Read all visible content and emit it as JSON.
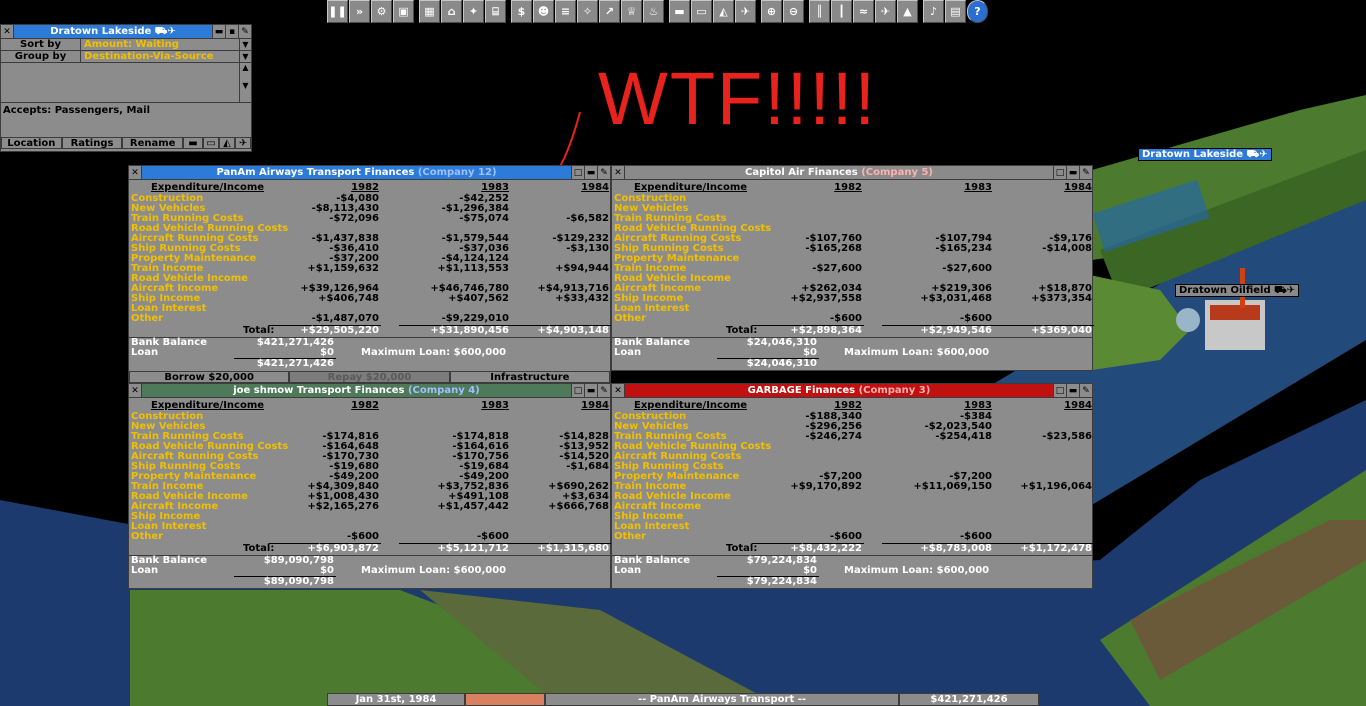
{
  "annotation": {
    "text": "WTF!!!!!",
    "color": "#e8221c"
  },
  "toolbar": {
    "icons": [
      "pause-icon",
      "fast-forward-icon",
      "settings-icon",
      "save-icon",
      "minimap-icon",
      "town-directory-icon",
      "subsidies-icon",
      "station-list-icon",
      "finances-icon",
      "company-general-icon",
      "story-book-icon",
      "goal-list-icon",
      "graphs-icon",
      "league-icon",
      "industry-icon",
      "train-list-icon",
      "road-vehicle-list-icon",
      "ship-list-icon",
      "aircraft-list-icon",
      "zoom-in-icon",
      "zoom-out-icon",
      "build-rail-icon",
      "build-road-icon",
      "build-water-icon",
      "build-air-icon",
      "landscaping-icon",
      "music-icon",
      "messages-icon",
      "help-icon"
    ]
  },
  "station_window": {
    "title": "Dratown Lakeside",
    "sort_label": "Sort by",
    "sort_value": "Amount: Waiting",
    "group_label": "Group by",
    "group_value": "Destination-Via-Source",
    "accepts": "Accepts: Passengers, Mail",
    "buttons": {
      "location": "Location",
      "ratings": "Ratings",
      "rename": "Rename"
    }
  },
  "signs": {
    "station": "Dratown Lakeside",
    "oilfield": "Dratown Oilfield"
  },
  "years": [
    "1982",
    "1983",
    "1984"
  ],
  "row_labels": [
    "Construction",
    "New Vehicles",
    "Train Running Costs",
    "Road Vehicle Running Costs",
    "Aircraft Running Costs",
    "Ship Running Costs",
    "Property Maintenance",
    "Train Income",
    "Road Vehicle Income",
    "Aircraft Income",
    "Ship Income",
    "Loan Interest",
    "Other"
  ],
  "labels": {
    "exp_income": "Expenditure/Income",
    "total": "Total:",
    "bank_balance": "Bank Balance",
    "loan": "Loan",
    "max_loan": "Maximum Loan:"
  },
  "finances": [
    {
      "company": "PanAm Airways Transport Finances",
      "company_no": "(Company 12)",
      "title_color": "#2d7bd8",
      "cells": [
        [
          "-$4,080",
          "-$42,252",
          ""
        ],
        [
          "-$8,113,430",
          "-$1,296,384",
          ""
        ],
        [
          "-$72,096",
          "-$75,074",
          "-$6,582"
        ],
        [
          "",
          "",
          ""
        ],
        [
          "-$1,437,838",
          "-$1,579,544",
          "-$129,232"
        ],
        [
          "-$36,410",
          "-$37,036",
          "-$3,130"
        ],
        [
          "-$37,200",
          "-$4,124,124",
          ""
        ],
        [
          "+$1,159,632",
          "+$1,113,553",
          "+$94,944"
        ],
        [
          "",
          "",
          ""
        ],
        [
          "+$39,126,964",
          "+$46,746,780",
          "+$4,913,716"
        ],
        [
          "+$406,748",
          "+$407,562",
          "+$33,432"
        ],
        [
          "",
          "",
          ""
        ],
        [
          "-$1,487,070",
          "-$9,229,010",
          ""
        ]
      ],
      "totals": [
        "+$29,505,220",
        "+$31,890,456",
        "+$4,903,148"
      ],
      "bank_balance": "$421,271,426",
      "loan": "$0",
      "max_loan": "$600,000",
      "net": "$421,271,426",
      "buttons": {
        "borrow": "Borrow $20,000",
        "repay": "Repay $20,000",
        "infrastructure": "Infrastructure"
      }
    },
    {
      "company": "Capitol Air Finances",
      "company_no": "(Company 5)",
      "title_color": "#8a8a8a",
      "cells": [
        [
          "",
          "",
          ""
        ],
        [
          "",
          "",
          ""
        ],
        [
          "",
          "",
          ""
        ],
        [
          "",
          "",
          ""
        ],
        [
          "-$107,760",
          "-$107,794",
          "-$9,176"
        ],
        [
          "-$165,268",
          "-$165,234",
          "-$14,008"
        ],
        [
          "",
          "",
          ""
        ],
        [
          "-$27,600",
          "-$27,600",
          ""
        ],
        [
          "",
          "",
          ""
        ],
        [
          "+$262,034",
          "+$219,306",
          "+$18,870"
        ],
        [
          "+$2,937,558",
          "+$3,031,468",
          "+$373,354"
        ],
        [
          "",
          "",
          ""
        ],
        [
          "",
          "",
          ""
        ],
        [
          "-$600",
          "-$600",
          ""
        ]
      ],
      "totals": [
        "+$2,898,364",
        "+$2,949,546",
        "+$369,040"
      ],
      "bank_balance": "$24,046,310",
      "loan": "$0",
      "max_loan": "$600,000",
      "net": "$24,046,310"
    },
    {
      "company": "joe shmow Transport Finances",
      "company_no": "(Company 4)",
      "title_color": "#4f7a5a",
      "cells": [
        [
          "",
          "",
          ""
        ],
        [
          "",
          "",
          ""
        ],
        [
          "-$174,816",
          "-$174,818",
          "-$14,828"
        ],
        [
          "-$164,648",
          "-$164,616",
          "-$13,952"
        ],
        [
          "-$170,730",
          "-$170,756",
          "-$14,520"
        ],
        [
          "-$19,680",
          "-$19,684",
          "-$1,684"
        ],
        [
          "-$49,200",
          "-$49,200",
          ""
        ],
        [
          "+$4,309,840",
          "+$3,752,836",
          "+$690,262"
        ],
        [
          "+$1,008,430",
          "+$491,108",
          "+$3,634"
        ],
        [
          "+$2,165,276",
          "+$1,457,442",
          "+$666,768"
        ],
        [
          "",
          "",
          ""
        ],
        [
          "",
          "",
          ""
        ],
        [
          "-$600",
          "-$600",
          ""
        ]
      ],
      "totals": [
        "+$6,903,872",
        "+$5,121,712",
        "+$1,315,680"
      ],
      "bank_balance": "$89,090,798",
      "loan": "$0",
      "max_loan": "$600,000",
      "net": "$89,090,798"
    },
    {
      "company": "GARBAGE Finances",
      "company_no": "(Company 3)",
      "title_color": "#c01010",
      "cells": [
        [
          "-$188,340",
          "-$384",
          ""
        ],
        [
          "-$296,256",
          "-$2,023,540",
          ""
        ],
        [
          "-$246,274",
          "-$254,418",
          "-$23,586"
        ],
        [
          "",
          "",
          ""
        ],
        [
          "",
          "",
          ""
        ],
        [
          "",
          "",
          ""
        ],
        [
          "-$7,200",
          "-$7,200",
          ""
        ],
        [
          "+$9,170,892",
          "+$11,069,150",
          "+$1,196,064"
        ],
        [
          "",
          "",
          ""
        ],
        [
          "",
          "",
          ""
        ],
        [
          "",
          "",
          ""
        ],
        [
          "",
          "",
          ""
        ],
        [
          "-$600",
          "-$600",
          ""
        ]
      ],
      "totals": [
        "+$8,432,222",
        "+$8,783,008",
        "+$1,172,478"
      ],
      "bank_balance": "$79,224,834",
      "loan": "$0",
      "max_loan": "$600,000",
      "net": "$79,224,834"
    }
  ],
  "status": {
    "date": "Jan 31st, 1984",
    "news": "-- PanAm Airways Transport --",
    "money": "$421,271,426"
  }
}
